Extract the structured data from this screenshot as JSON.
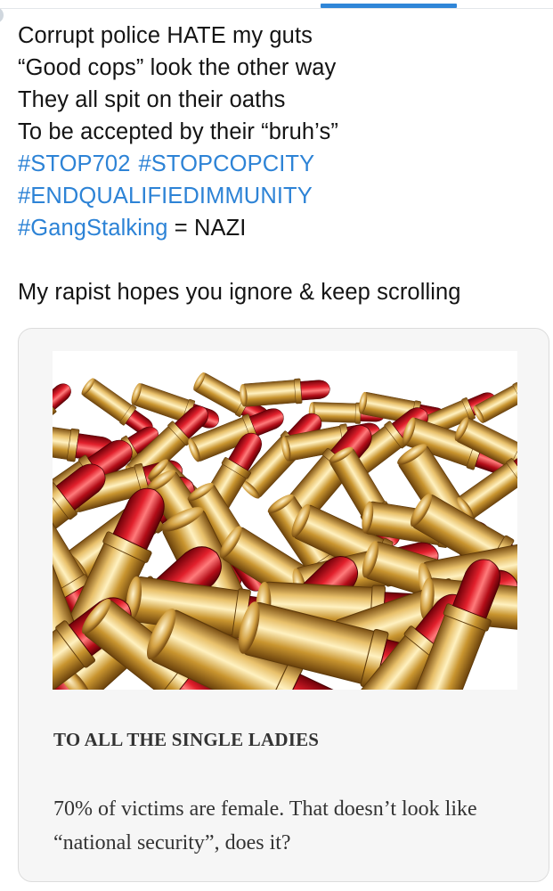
{
  "post": {
    "lines": [
      "Corrupt police HATE my guts",
      "“Good cops” look the other way",
      "They all spit on their oaths",
      "To be accepted by their “bruh’s”"
    ],
    "hashtags": {
      "stop702": "#STOP702",
      "stopcopcity": "#STOPCOPCITY",
      "endqualifiedimmunity": "#ENDQUALIFIEDIMMUNITY",
      "gangstalking": "#GangStalking"
    },
    "gangstalking_suffix": " = NAZI",
    "closing_line": "My rapist hopes you ignore & keep scrolling"
  },
  "link_card": {
    "image": "red-lipsticks-pile",
    "title": "TO ALL THE SINGLE LADIES",
    "description": "70% of victims are female. That doesn’t look like “national security”, does it?"
  },
  "colors": {
    "hashtag": "#2d83d6",
    "text": "#141414",
    "tab_indicator": "#2f86d8",
    "card_background": "#f6f6f6"
  }
}
